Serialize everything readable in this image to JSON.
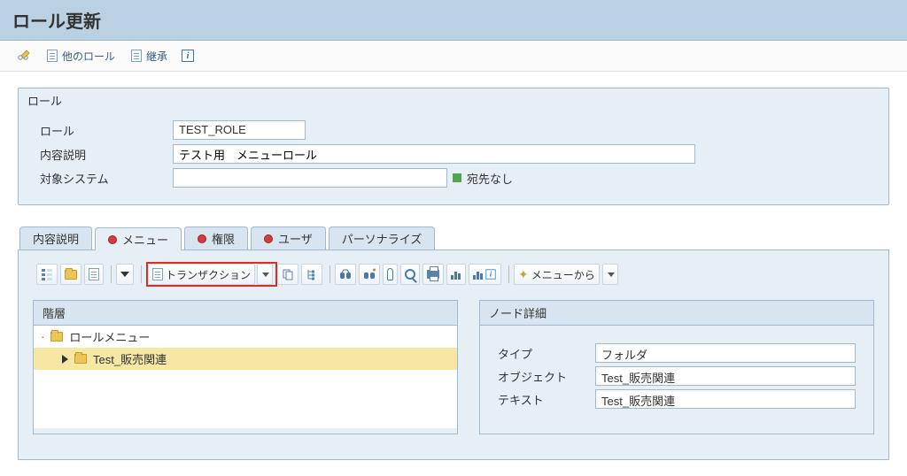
{
  "header": {
    "title": "ロール更新"
  },
  "top_toolbar": {
    "other_role_label": "他のロール",
    "inherit_label": "継承"
  },
  "role_group": {
    "title": "ロール",
    "labels": {
      "role": "ロール",
      "desc": "内容説明",
      "target": "対象システム"
    },
    "values": {
      "role": "TEST_ROLE",
      "desc": "テスト用　メニューロール",
      "target": ""
    },
    "target_status": "宛先なし"
  },
  "tabs": {
    "items": [
      {
        "label": "内容説明",
        "red": false,
        "active": false
      },
      {
        "label": "メニュー",
        "red": true,
        "active": true
      },
      {
        "label": "権限",
        "red": true,
        "active": false
      },
      {
        "label": "ユーザ",
        "red": true,
        "active": false
      },
      {
        "label": "パーソナライズ",
        "red": false,
        "active": false
      }
    ]
  },
  "inner_toolbar": {
    "transaction_label": "トランザクション",
    "menu_from_label": "メニューから"
  },
  "hierarchy": {
    "title": "階層",
    "root_label": "ロールメニュー",
    "selected_label": "Test_販売関連"
  },
  "detail": {
    "title": "ノード詳細",
    "labels": {
      "type": "タイプ",
      "object": "オブジェクト",
      "text": "テキスト"
    },
    "values": {
      "type": "フォルダ",
      "object": "Test_販売関連",
      "text": "Test_販売関連"
    }
  }
}
